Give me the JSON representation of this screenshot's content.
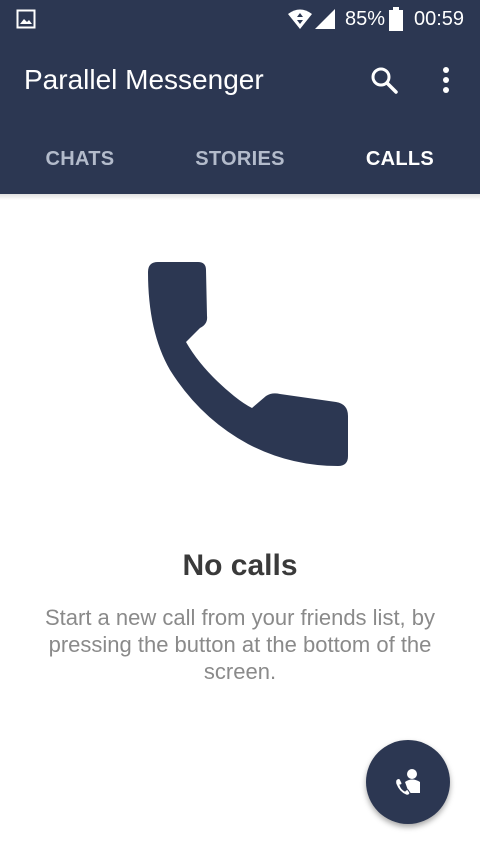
{
  "status_bar": {
    "notification_icon": "image-icon",
    "wifi_icon": "wifi-icon",
    "signal_icon": "signal-icon",
    "battery_percent": "85%",
    "battery_icon": "battery-icon",
    "time": "00:59"
  },
  "toolbar": {
    "title": "Parallel Messenger",
    "search_icon": "search-icon",
    "overflow_icon": "more-vert-icon"
  },
  "tabs": [
    {
      "label": "CHATS",
      "active": false
    },
    {
      "label": "STORIES",
      "active": false
    },
    {
      "label": "CALLS",
      "active": true
    }
  ],
  "empty_state": {
    "illustration_icon": "phone-icon",
    "title": "No calls",
    "message": "Start a new call from your friends list, by pressing the button at the bottom of the screen."
  },
  "fab": {
    "icon": "contact-call-icon"
  },
  "colors": {
    "primary": "#2c3752",
    "tab_inactive": "#b3bbcb",
    "title_text": "#3a3a3a",
    "body_text": "#8a8a8a"
  }
}
